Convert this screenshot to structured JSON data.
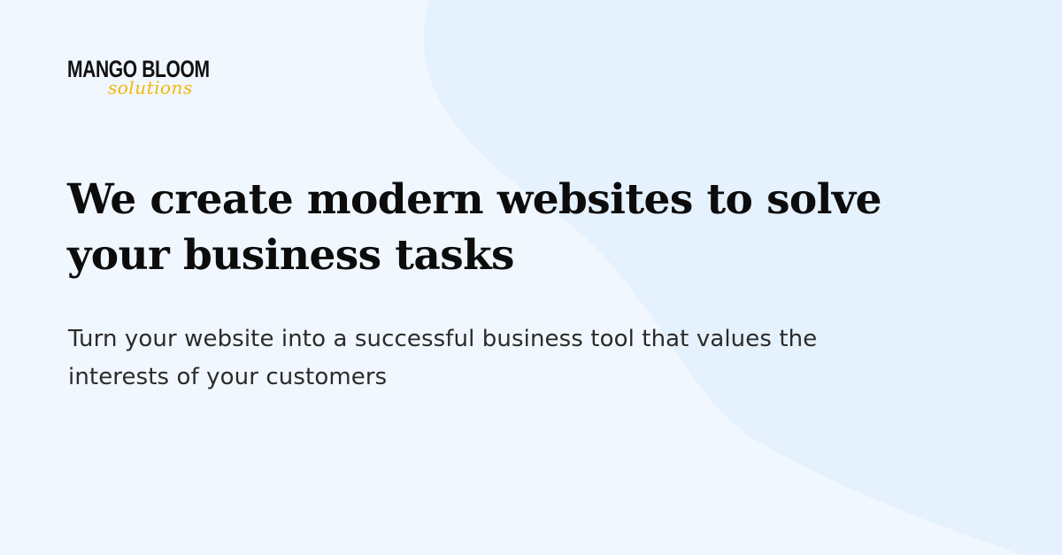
{
  "brand": {
    "name": "MANGO BLOOM",
    "tagline": "solutions",
    "accent_color": "#f2b705",
    "text_color": "#111111"
  },
  "hero": {
    "headline_line1": "We create modern websites to solve",
    "headline_line2": "your business tasks",
    "subtext_line1": "Turn your website into a successful business tool that values the",
    "subtext_line2": "interests of your customers"
  },
  "colors": {
    "background": "#f1f7fe",
    "shape": "#e5f1fd"
  }
}
